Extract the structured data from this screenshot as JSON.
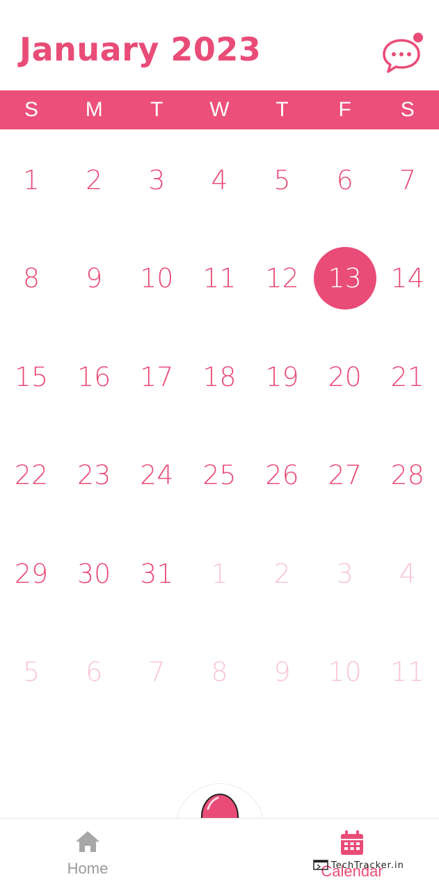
{
  "header": {
    "title": "January 2023"
  },
  "colors": {
    "accent": "#e94c77",
    "dim": "#f7c6d4"
  },
  "weekdays": [
    "S",
    "M",
    "T",
    "W",
    "T",
    "F",
    "S"
  ],
  "weeks": [
    [
      {
        "d": "1"
      },
      {
        "d": "2"
      },
      {
        "d": "3"
      },
      {
        "d": "4"
      },
      {
        "d": "5"
      },
      {
        "d": "6"
      },
      {
        "d": "7"
      }
    ],
    [
      {
        "d": "8"
      },
      {
        "d": "9"
      },
      {
        "d": "10"
      },
      {
        "d": "11"
      },
      {
        "d": "12"
      },
      {
        "d": "13",
        "selected": true
      },
      {
        "d": "14"
      }
    ],
    [
      {
        "d": "15"
      },
      {
        "d": "16"
      },
      {
        "d": "17"
      },
      {
        "d": "18"
      },
      {
        "d": "19"
      },
      {
        "d": "20"
      },
      {
        "d": "21"
      }
    ],
    [
      {
        "d": "22"
      },
      {
        "d": "23"
      },
      {
        "d": "24"
      },
      {
        "d": "25"
      },
      {
        "d": "26"
      },
      {
        "d": "27"
      },
      {
        "d": "28"
      }
    ],
    [
      {
        "d": "29"
      },
      {
        "d": "30"
      },
      {
        "d": "31"
      },
      {
        "d": "1",
        "dim": true
      },
      {
        "d": "2",
        "dim": true
      },
      {
        "d": "3",
        "dim": true
      },
      {
        "d": "4",
        "dim": true
      }
    ],
    [
      {
        "d": "5",
        "dim": true
      },
      {
        "d": "6",
        "dim": true
      },
      {
        "d": "7",
        "dim": true
      },
      {
        "d": "8",
        "dim": true
      },
      {
        "d": "9",
        "dim": true
      },
      {
        "d": "10",
        "dim": true
      },
      {
        "d": "11",
        "dim": true
      }
    ]
  ],
  "nav": {
    "home_label": "Home",
    "calendar_label": "Calendar"
  },
  "watermark": "TechTracker.in"
}
